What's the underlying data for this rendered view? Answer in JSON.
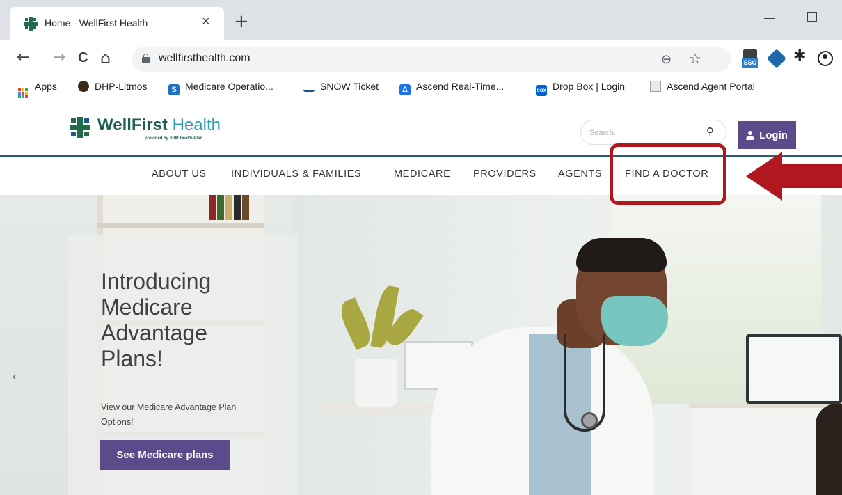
{
  "browser": {
    "tab": {
      "title": "Home - WellFirst Health",
      "close": "×"
    },
    "new_tab": "+",
    "address": {
      "url": "wellfirsthealth.com"
    },
    "nav": {
      "back": "←",
      "forward": "→",
      "reload": "C",
      "home": "⌂"
    },
    "icons": {
      "zoom": "⊖",
      "star": "☆",
      "puzzle": "✱"
    },
    "extension_sso_label": "SSO"
  },
  "bookmarks": [
    {
      "label": "Apps",
      "icon": "apps-grid-icon"
    },
    {
      "label": "DHP-Litmos",
      "icon": "litmos-icon",
      "color": "#3a2a1a"
    },
    {
      "label": "Medicare Operatio...",
      "icon": "sharepoint-icon",
      "color": "#1f6fc5",
      "glyph": "S"
    },
    {
      "label": "SNOW Ticket",
      "icon": "snow-icon",
      "color": "#1d4e8f"
    },
    {
      "label": "Ascend Real-Time...",
      "icon": "ascend-icon",
      "color": "#1a73e8",
      "glyph": "Δ"
    },
    {
      "label": "Drop Box | Login",
      "icon": "box-icon",
      "color": "#0061d5",
      "glyph": "box"
    },
    {
      "label": "Ascend Agent Portal",
      "icon": "page-icon",
      "color": "#9aa0a6"
    }
  ],
  "site": {
    "logo": {
      "name_primary": "WellFirst",
      "name_accent": "Health",
      "tagline": "provided by SSM Health Plan"
    },
    "search": {
      "placeholder": "Search..."
    },
    "login_label": "Login",
    "nav": [
      "ABOUT US",
      "INDIVIDUALS & FAMILIES",
      "MEDICARE",
      "PROVIDERS",
      "AGENTS",
      "FIND A DOCTOR"
    ],
    "hero": {
      "title": "Introducing Medicare Advantage Plans!",
      "subtitle": "View our Medicare Advantage Plan Options!",
      "cta": "See Medicare plans",
      "prev": "‹"
    }
  },
  "colors": {
    "brand_purple": "#5b4b8a",
    "brand_green": "#1f5f52",
    "highlight_red": "#b0171f",
    "nav_rule": "#2c5c72"
  }
}
